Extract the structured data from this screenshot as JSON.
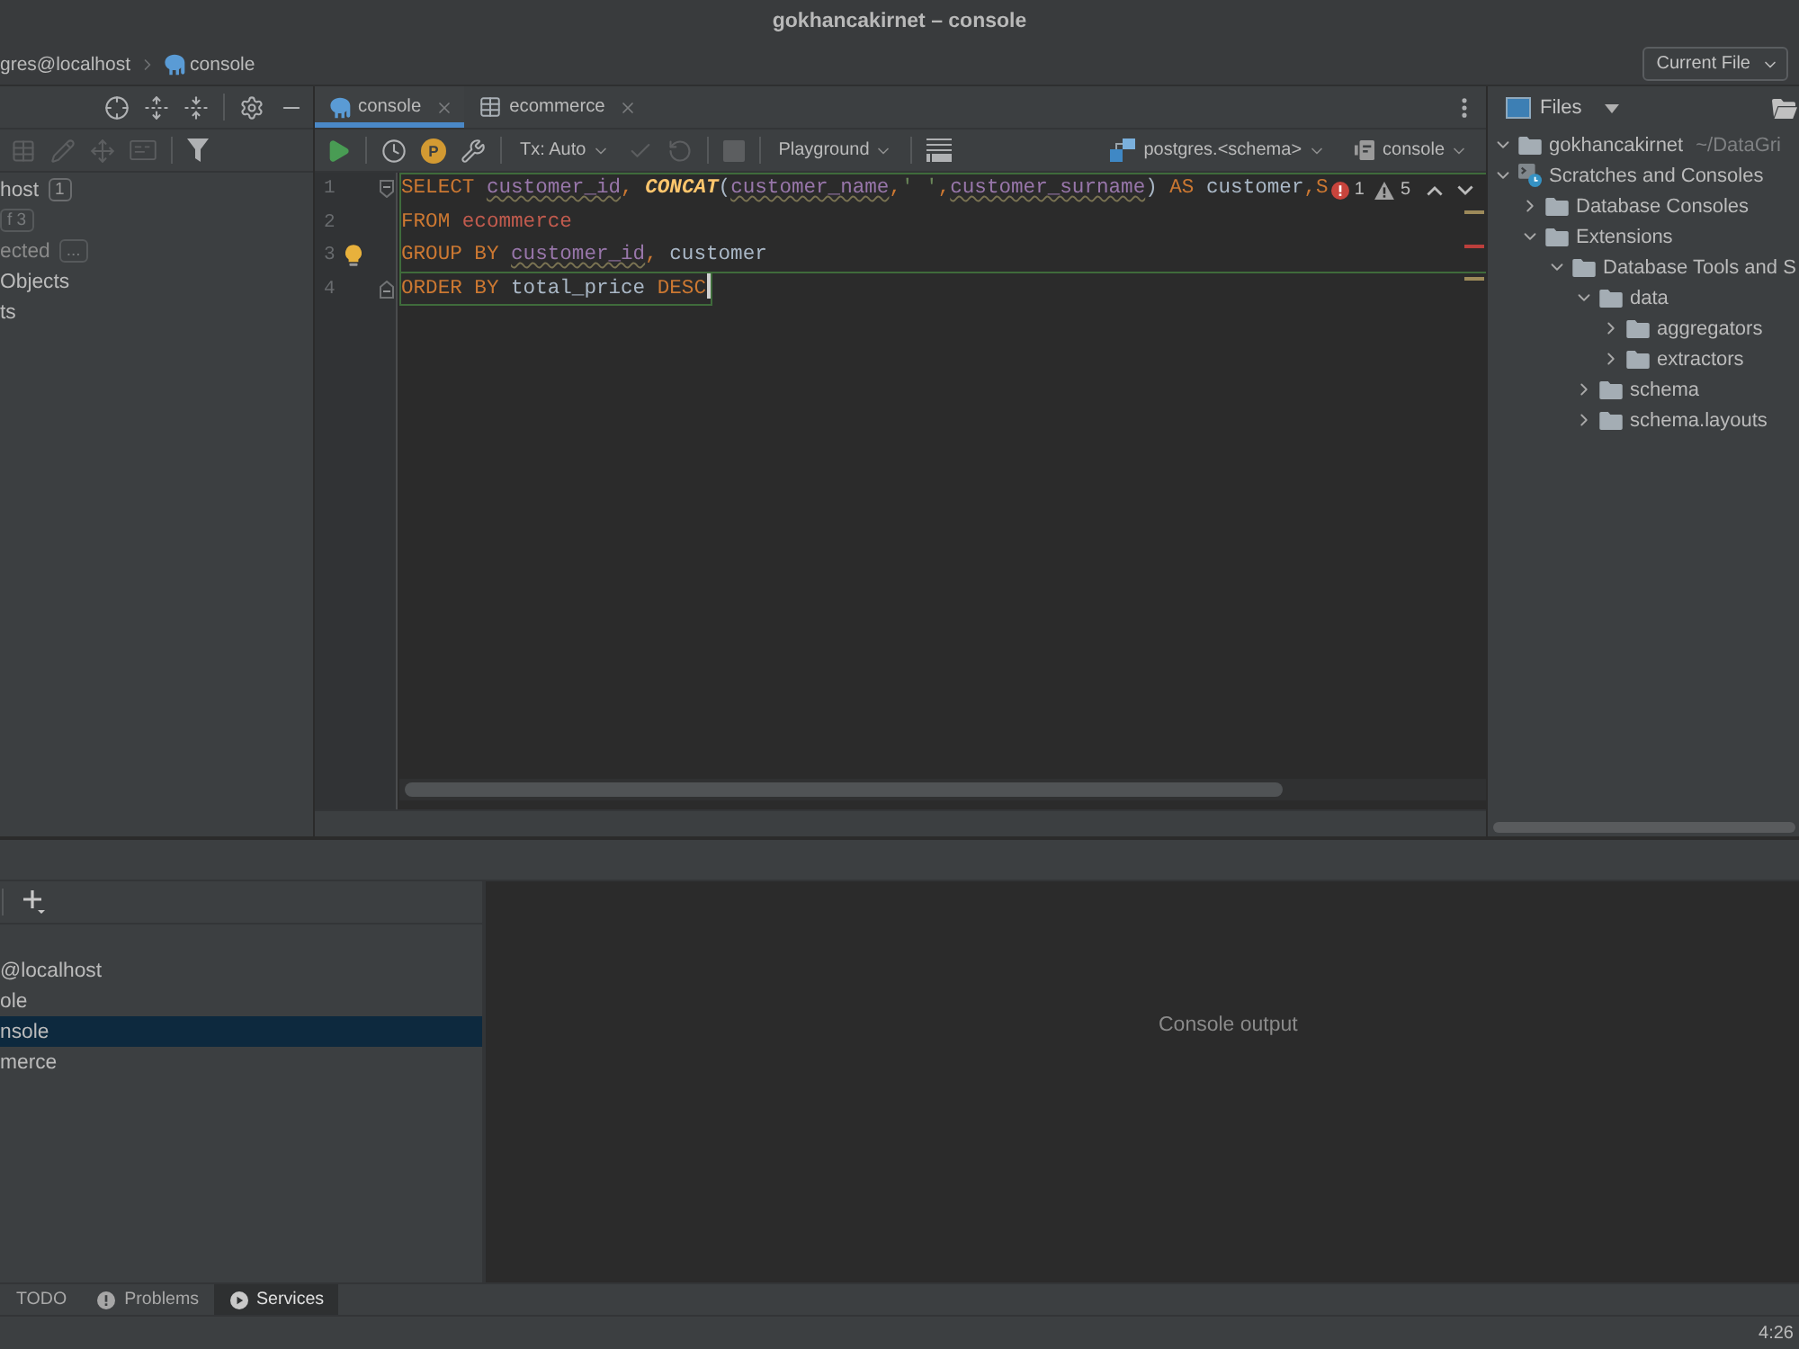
{
  "window": {
    "title": "gokhancakirnet – console"
  },
  "navigation_bar": {
    "breadcrumbs": [
      {
        "label": "gres@localhost",
        "kind": "datasource"
      },
      {
        "label": "console",
        "kind": "console"
      }
    ],
    "run_configuration": {
      "label": "Current File"
    }
  },
  "database_panel": {
    "header_tools": [
      {
        "kind": "locate",
        "disabled": false
      },
      {
        "kind": "expand_all",
        "disabled": false
      },
      {
        "kind": "collapse_all",
        "disabled": false
      },
      {
        "kind": "separator"
      },
      {
        "kind": "settings",
        "disabled": false
      },
      {
        "kind": "hide",
        "disabled": false
      }
    ],
    "toolbar": [
      {
        "kind": "table",
        "disabled": true
      },
      {
        "kind": "edit",
        "disabled": true
      },
      {
        "kind": "jump",
        "disabled": true
      },
      {
        "kind": "console",
        "disabled": true
      },
      {
        "kind": "separator"
      },
      {
        "kind": "filter",
        "disabled": false
      }
    ],
    "tree": [
      {
        "label": "host",
        "badge": "1",
        "dimmed": false
      },
      {
        "badge": "f 3",
        "dimmed": true
      },
      {
        "label": "ected",
        "badge": "...",
        "dimmed": true
      },
      {
        "label": "Objects",
        "dimmed": false
      },
      {
        "label": "ts",
        "dimmed": false
      }
    ]
  },
  "editor": {
    "tabs": [
      {
        "label": "console",
        "kind": "console",
        "selected": true
      },
      {
        "label": "ecommerce",
        "kind": "table",
        "selected": false
      }
    ],
    "toolbar": [
      {
        "kind": "run",
        "disabled": false
      },
      {
        "kind": "separator"
      },
      {
        "kind": "history",
        "disabled": false
      },
      {
        "kind": "badge",
        "label": "P",
        "disabled": false
      },
      {
        "kind": "wrench",
        "disabled": false
      },
      {
        "kind": "separator"
      },
      {
        "kind": "dropdown",
        "label": "Tx: Auto",
        "disabled": false
      },
      {
        "kind": "commit",
        "disabled": true
      },
      {
        "kind": "rollback",
        "disabled": true
      },
      {
        "kind": "separator"
      },
      {
        "kind": "stop",
        "disabled": true
      },
      {
        "kind": "separator"
      },
      {
        "kind": "dropdown",
        "label": "Playground",
        "disabled": false
      },
      {
        "kind": "separator"
      },
      {
        "kind": "layout",
        "disabled": false
      }
    ],
    "data_source": {
      "label": "postgres.<schema>"
    },
    "session": {
      "label": "console"
    },
    "inspections": {
      "errors": "1",
      "warnings": "5"
    },
    "lines": [
      {
        "number": "1",
        "fold_start": true,
        "fold_end": false,
        "intention": false,
        "highlighted": true,
        "caret": false,
        "tokens": [
          {
            "text": "SELECT ",
            "kind": "keyword"
          },
          {
            "text": "customer_id",
            "kind": "column"
          },
          {
            "text": ", ",
            "kind": "punct"
          },
          {
            "text": "CONCAT",
            "kind": "function"
          },
          {
            "text": "(",
            "kind": "plain"
          },
          {
            "text": "customer_name",
            "kind": "column"
          },
          {
            "text": ",",
            "kind": "punct"
          },
          {
            "text": "' '",
            "kind": "string"
          },
          {
            "text": ",",
            "kind": "punct"
          },
          {
            "text": "customer_surname",
            "kind": "column"
          },
          {
            "text": ") ",
            "kind": "plain"
          },
          {
            "text": "AS ",
            "kind": "keyword"
          },
          {
            "text": "customer",
            "kind": "plain"
          },
          {
            "text": ",",
            "kind": "punct"
          },
          {
            "text": "S",
            "kind": "keyword"
          }
        ]
      },
      {
        "number": "2",
        "fold_start": false,
        "fold_end": false,
        "intention": false,
        "highlighted": true,
        "caret": false,
        "tokens": [
          {
            "text": "FROM ",
            "kind": "keyword"
          },
          {
            "text": "ecommerce",
            "kind": "table"
          }
        ]
      },
      {
        "number": "3",
        "fold_start": false,
        "fold_end": false,
        "intention": true,
        "highlighted": true,
        "caret": false,
        "tokens": [
          {
            "text": "GROUP BY ",
            "kind": "keyword"
          },
          {
            "text": "customer_id",
            "kind": "column"
          },
          {
            "text": ", ",
            "kind": "punct"
          },
          {
            "text": "customer",
            "kind": "plain"
          }
        ]
      },
      {
        "number": "4",
        "fold_start": false,
        "fold_end": true,
        "intention": false,
        "highlighted": true,
        "caret": true,
        "tokens": [
          {
            "text": "ORDER BY ",
            "kind": "keyword"
          },
          {
            "text": "total_price ",
            "kind": "plain"
          },
          {
            "text": "DESC",
            "kind": "keyword"
          }
        ]
      }
    ],
    "stripe_marks": [
      {
        "kind": "warning"
      },
      {
        "kind": "error"
      },
      {
        "kind": "warning"
      }
    ]
  },
  "files_panel": {
    "title": "Files",
    "tree": [
      {
        "label": "gokhancakirnet",
        "hint": "~/DataGri",
        "kind": "folder",
        "expanded": true
      },
      {
        "label": "Scratches and Consoles",
        "kind": "scratches",
        "expanded": true,
        "children": [
          {
            "label": "Database Consoles",
            "kind": "folder",
            "expanded": false
          },
          {
            "label": "Extensions",
            "kind": "folder",
            "expanded": true,
            "children": [
              {
                "label": "Database Tools and S",
                "kind": "folder",
                "expanded": true,
                "children": [
                  {
                    "label": "data",
                    "kind": "folder",
                    "expanded": true,
                    "children": [
                      {
                        "label": "aggregators",
                        "kind": "folder",
                        "expanded": false
                      },
                      {
                        "label": "extractors",
                        "kind": "folder",
                        "expanded": false
                      }
                    ]
                  },
                  {
                    "label": "schema",
                    "kind": "folder",
                    "expanded": false
                  },
                  {
                    "label": "schema.layouts",
                    "kind": "folder",
                    "expanded": false
                  }
                ]
              }
            ]
          }
        ]
      }
    ]
  },
  "services": {
    "tree": [
      {
        "label": "@localhost",
        "selected": false
      },
      {
        "label": "ole",
        "selected": false
      },
      {
        "label": "nsole",
        "selected": true
      },
      {
        "label": "merce",
        "selected": false
      }
    ],
    "console": {
      "message": "Console output"
    }
  },
  "tool_windows": [
    {
      "label": "TODO",
      "kind": "todo",
      "selected": false
    },
    {
      "label": "Problems",
      "kind": "problems",
      "selected": false
    },
    {
      "label": "Services",
      "kind": "services",
      "selected": true
    }
  ],
  "status_bar": {
    "position": "4:26"
  }
}
